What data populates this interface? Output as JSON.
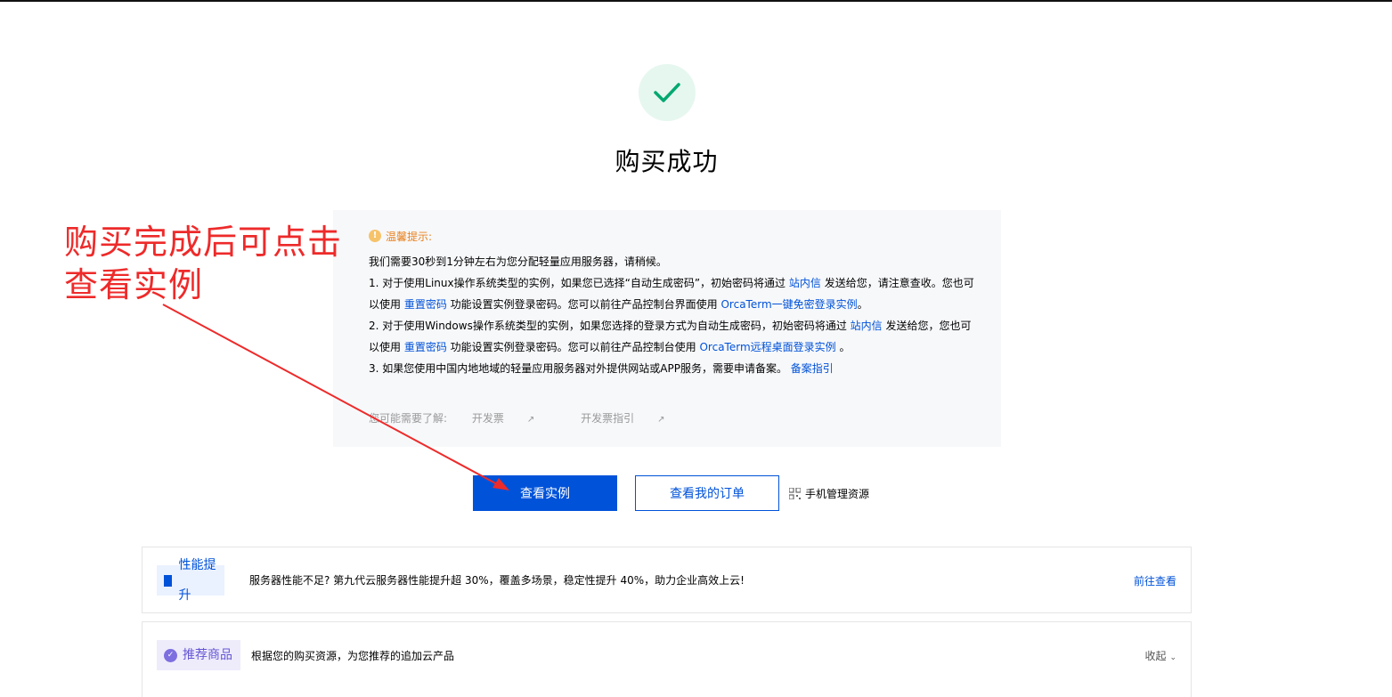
{
  "success": {
    "title": "购买成功"
  },
  "notice": {
    "header": "温馨提示:",
    "intro": "我们需要30秒到1分钟左右为您分配轻量应用服务器，请稍候。",
    "item1_a": "1. 对于使用Linux操作系统类型的实例，如果您已选择“自动生成密码”，初始密码将通过 ",
    "item1_link1": "站内信",
    "item1_b": " 发送给您，请注意查收。您也可",
    "item1_c": "以使用 ",
    "item1_link2": "重置密码",
    "item1_d": " 功能设置实例登录密码。您可以前往产品控制台界面使用 ",
    "item1_link3": "OrcaTerm一键免密登录实例",
    "item1_e": "。",
    "item2_a": "2. 对于使用Windows操作系统类型的实例，如果您选择的登录方式为自动生成密码，初始密码将通过 ",
    "item2_link1": "站内信",
    "item2_b": " 发送给您，您也可",
    "item2_c": "以使用 ",
    "item2_link2": "重置密码",
    "item2_d": " 功能设置实例登录密码。您可以前往产品控制台使用 ",
    "item2_link3": "OrcaTerm远程桌面登录实例",
    "item2_e": " 。",
    "item3_a": "3. 如果您使用中国内地地域的轻量应用服务器对外提供网站或APP服务，需要申请备案。 ",
    "item3_link": "备案指引",
    "more_label": "您可能需要了解:",
    "more_link1": "开发票",
    "more_link2": "开发票指引"
  },
  "buttons": {
    "view_instance": "查看实例",
    "view_orders": "查看我的订单",
    "mobile_manage": "手机管理资源"
  },
  "annotation": {
    "line1": "购买完成后可点击",
    "line2": "查看实例"
  },
  "cards": {
    "performance": {
      "tag": "性能提升",
      "desc": "服务器性能不足? 第九代云服务器性能提升超 30%，覆盖多场景，稳定性提升 40%，助力企业高效上云!",
      "action": "前往查看"
    },
    "recommend": {
      "tag": "推荐商品",
      "desc": "根据您的购买资源，为您推荐的追加云产品",
      "action": "收起"
    }
  },
  "colors": {
    "primary": "#0052d9",
    "success": "#00a870",
    "warning": "#e8801b",
    "annotation": "#ee2a2a"
  }
}
